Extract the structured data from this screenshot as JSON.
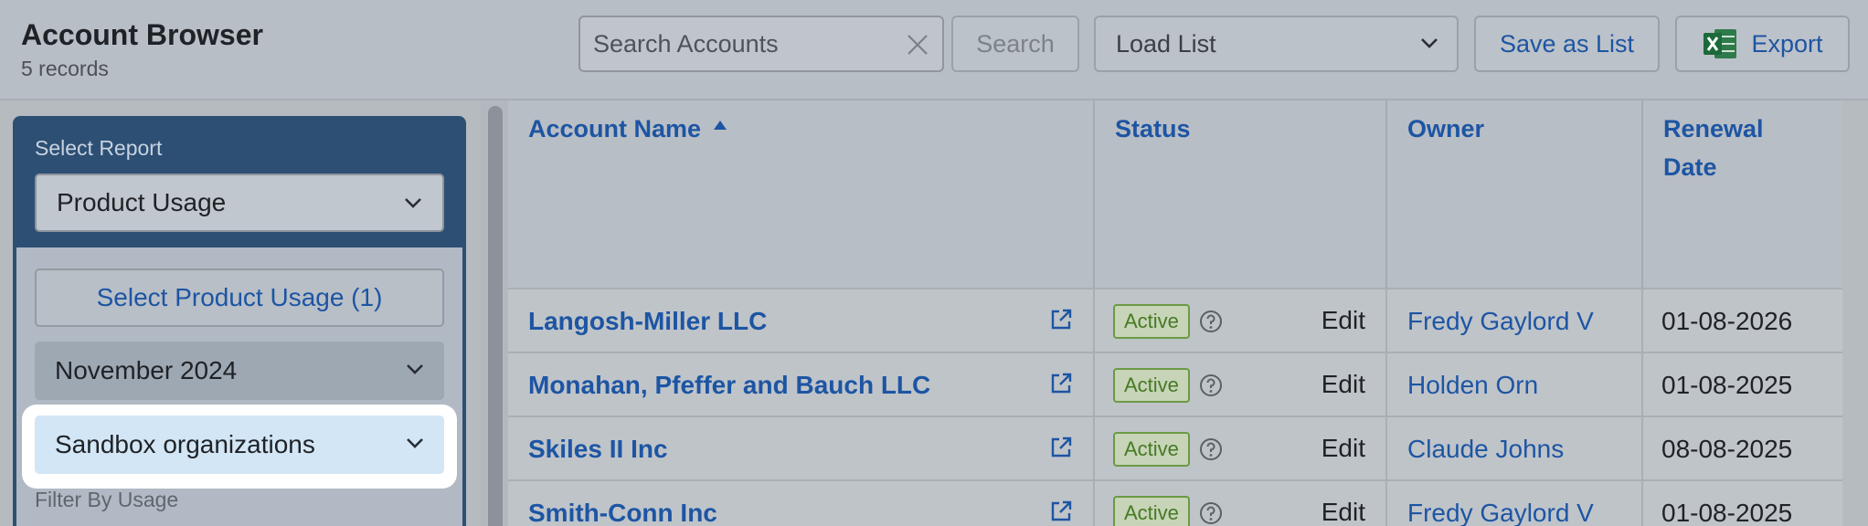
{
  "header": {
    "title": "Account Browser",
    "record_count": "5 records",
    "search_placeholder": "Search Accounts",
    "search_button": "Search",
    "load_list": "Load List",
    "save_as_list": "Save as List",
    "export": "Export"
  },
  "sidebar": {
    "select_report_label": "Select Report",
    "selected_report": "Product Usage",
    "select_product_usage_button": "Select Product Usage (1)",
    "month": "November 2024",
    "org_type": "Sandbox organizations",
    "filter_by_usage_label": "Filter By Usage"
  },
  "table": {
    "columns": [
      "Account Name",
      "Status",
      "Owner",
      "Renewal Date"
    ],
    "sort_column": "Account Name",
    "rows": [
      {
        "name": "Langosh-Miller LLC",
        "status": "Active",
        "action": "Edit",
        "owner": "Fredy Gaylord V",
        "renewal": "01-08-2026"
      },
      {
        "name": "Monahan, Pfeffer and Bauch LLC",
        "status": "Active",
        "action": "Edit",
        "owner": "Holden Orn",
        "renewal": "01-08-2025"
      },
      {
        "name": "Skiles II Inc",
        "status": "Active",
        "action": "Edit",
        "owner": "Claude Johns",
        "renewal": "08-08-2025"
      },
      {
        "name": "Smith-Conn Inc",
        "status": "Active",
        "action": "Edit",
        "owner": "Fredy Gaylord V",
        "renewal": "01-08-2025"
      }
    ]
  },
  "colors": {
    "link": "#1d55a3",
    "sidebar": "#2d4f74",
    "status_active": "#467a23"
  }
}
